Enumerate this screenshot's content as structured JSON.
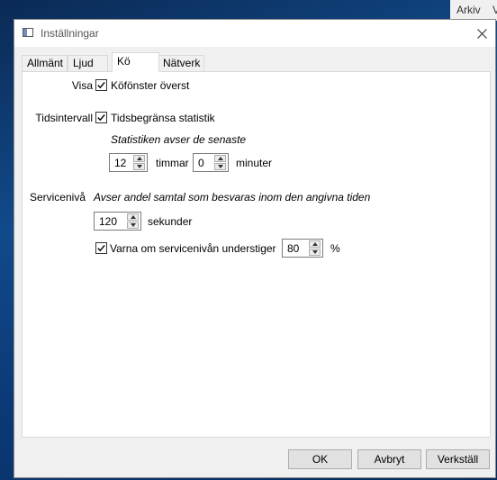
{
  "background_app": {
    "menu": [
      "Arkiv",
      "V"
    ]
  },
  "window": {
    "title": "Inställningar",
    "icon": "app-window-icon",
    "close_icon": "close-icon"
  },
  "tabs": [
    {
      "label": "Allmänt",
      "active": false
    },
    {
      "label": "Ljud",
      "active": false
    },
    {
      "label": "Kö",
      "active": true
    },
    {
      "label": "Nätverk",
      "active": false
    }
  ],
  "settings": {
    "visa": {
      "label": "Visa",
      "checkbox_label": "Köfönster överst",
      "checked": true
    },
    "tidsintervall": {
      "label": "Tidsintervall",
      "checkbox_label": "Tidsbegränsa statistik",
      "checked": true,
      "note": "Statistiken avser de senaste",
      "hours_value": "12",
      "hours_unit": "timmar",
      "minutes_value": "0",
      "minutes_unit": "minuter"
    },
    "serviceniva": {
      "label": "Servicenivå",
      "description": "Avser andel samtal som besvaras inom den angivna tiden",
      "seconds_value": "120",
      "seconds_unit": "sekunder",
      "warn_label": "Varna om servicenivån understiger",
      "warn_checked": true,
      "warn_value": "80",
      "warn_unit": "%"
    }
  },
  "buttons": {
    "ok": "OK",
    "cancel": "Avbryt",
    "apply": "Verkställ"
  }
}
